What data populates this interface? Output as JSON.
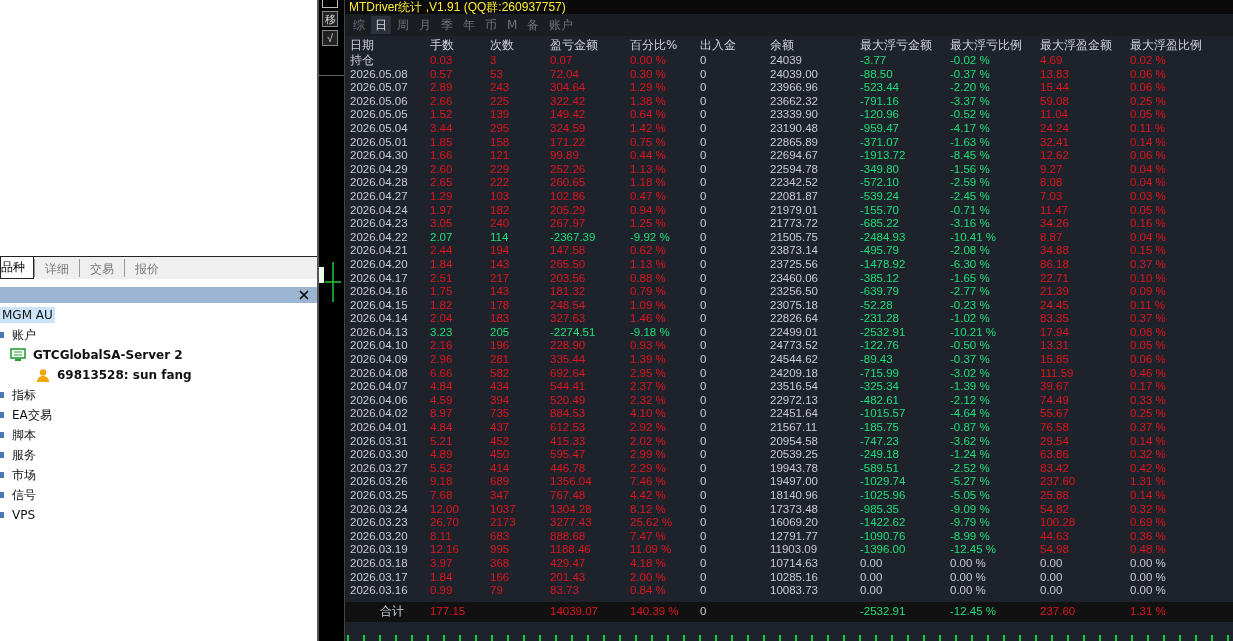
{
  "left_panel": {
    "tabs": [
      {
        "label": "品种",
        "selected": true
      },
      {
        "label": "详细",
        "selected": false
      },
      {
        "label": "交易",
        "selected": false
      },
      {
        "label": "报价",
        "selected": false
      }
    ],
    "navigator": {
      "items": [
        {
          "label": "MGM AU",
          "kind": "root",
          "selected": true
        },
        {
          "label": "账户",
          "kind": "accounts",
          "selected": false,
          "children": [
            {
              "label": "GTCGlobalSA-Server 2",
              "kind": "server",
              "selected": false,
              "children": [
                {
                  "label": "69813528: sun fang",
                  "kind": "user",
                  "selected": false
                }
              ]
            }
          ]
        },
        {
          "label": "指标",
          "kind": "folder",
          "selected": false
        },
        {
          "label": "EA交易",
          "kind": "folder",
          "selected": false
        },
        {
          "label": "脚本",
          "kind": "folder",
          "selected": false
        },
        {
          "label": "服务",
          "kind": "folder",
          "selected": false
        },
        {
          "label": "市场",
          "kind": "folder",
          "selected": false
        },
        {
          "label": "信号",
          "kind": "folder",
          "selected": false
        },
        {
          "label": "VPS",
          "kind": "folder",
          "selected": false
        }
      ]
    }
  },
  "side_buttons": [
    "移",
    "√"
  ],
  "stats": {
    "title": "MTDriver统计 ,V1.91 (QQ群:260937757)",
    "tabs": [
      {
        "label": "综",
        "selected": false
      },
      {
        "label": "日",
        "selected": true
      },
      {
        "label": "周",
        "selected": false
      },
      {
        "label": "月",
        "selected": false
      },
      {
        "label": "季",
        "selected": false
      },
      {
        "label": "年",
        "selected": false
      },
      {
        "label": "币",
        "selected": false
      },
      {
        "label": "M",
        "selected": false
      },
      {
        "label": "备",
        "selected": false
      },
      {
        "label": "账户",
        "selected": false
      }
    ],
    "columns": [
      "日期",
      "手数",
      "次数",
      "盈亏金额",
      "百分比%",
      "出入金",
      "余额",
      "最大浮亏金额",
      "最大浮亏比例",
      "最大浮盈金额",
      "最大浮盈比例"
    ],
    "rows": [
      {
        "cells": [
          "持仓",
          "0.03",
          "3",
          "0.07",
          "0.00 %",
          "0",
          "24039",
          "-3.77",
          "-0.02 %",
          "4.69",
          "0.02 %"
        ],
        "loss": false,
        "floating": true
      },
      {
        "cells": [
          "2026.05.08",
          "0.57",
          "53",
          "72.04",
          "0.30 %",
          "0",
          "24039.00",
          "-88.50",
          "-0.37 %",
          "13.83",
          "0.06 %"
        ],
        "loss": false,
        "floating": true
      },
      {
        "cells": [
          "2026.05.07",
          "2.89",
          "243",
          "304.64",
          "1.29 %",
          "0",
          "23966.96",
          "-523.44",
          "-2.20 %",
          "15.44",
          "0.06 %"
        ],
        "loss": false,
        "floating": true
      },
      {
        "cells": [
          "2026.05.06",
          "2.66",
          "225",
          "322.42",
          "1.38 %",
          "0",
          "23662.32",
          "-791.16",
          "-3.37 %",
          "59.08",
          "0.25 %"
        ],
        "loss": false,
        "floating": true
      },
      {
        "cells": [
          "2026.05.05",
          "1.52",
          "139",
          "149.42",
          "0.64 %",
          "0",
          "23339.90",
          "-120.96",
          "-0.52 %",
          "11.04",
          "0.05 %"
        ],
        "loss": false,
        "floating": true
      },
      {
        "cells": [
          "2026.05.04",
          "3.44",
          "295",
          "324.59",
          "1.42 %",
          "0",
          "23190.48",
          "-959.47",
          "-4.17 %",
          "24.24",
          "0.11 %"
        ],
        "loss": false,
        "floating": true
      },
      {
        "cells": [
          "2026.05.01",
          "1.85",
          "158",
          "171.22",
          "0.75 %",
          "0",
          "22865.89",
          "-371.07",
          "-1.63 %",
          "32.41",
          "0.14 %"
        ],
        "loss": false,
        "floating": true
      },
      {
        "cells": [
          "2026.04.30",
          "1.66",
          "121",
          "99.89",
          "0.44 %",
          "0",
          "22694.67",
          "-1913.72",
          "-8.45 %",
          "12.62",
          "0.06 %"
        ],
        "loss": false,
        "floating": true
      },
      {
        "cells": [
          "2026.04.29",
          "2.60",
          "229",
          "252.26",
          "1.13 %",
          "0",
          "22594.78",
          "-349.80",
          "-1.56 %",
          "9.27",
          "0.04 %"
        ],
        "loss": false,
        "floating": true
      },
      {
        "cells": [
          "2026.04.28",
          "2.65",
          "222",
          "260.65",
          "1.18 %",
          "0",
          "22342.52",
          "-572.10",
          "-2.59 %",
          "8.08",
          "0.04 %"
        ],
        "loss": false,
        "floating": true
      },
      {
        "cells": [
          "2026.04.27",
          "1.29",
          "103",
          "102.86",
          "0.47 %",
          "0",
          "22081.87",
          "-539.24",
          "-2.45 %",
          "7.03",
          "0.03 %"
        ],
        "loss": false,
        "floating": true
      },
      {
        "cells": [
          "2026.04.24",
          "1.97",
          "182",
          "205.29",
          "0.94 %",
          "0",
          "21979.01",
          "-155.70",
          "-0.71 %",
          "11.47",
          "0.05 %"
        ],
        "loss": false,
        "floating": true
      },
      {
        "cells": [
          "2026.04.23",
          "3.05",
          "240",
          "267.97",
          "1.25 %",
          "0",
          "21773.72",
          "-685.22",
          "-3.16 %",
          "34.26",
          "0.16 %"
        ],
        "loss": false,
        "floating": true
      },
      {
        "cells": [
          "2026.04.22",
          "2.07",
          "114",
          "-2367.39",
          "-9.92 %",
          "0",
          "21505.75",
          "-2484.93",
          "-10.41 %",
          "8.87",
          "0.04 %"
        ],
        "loss": true,
        "floating": true
      },
      {
        "cells": [
          "2026.04.21",
          "2.44",
          "194",
          "147.58",
          "0.62 %",
          "0",
          "23873.14",
          "-495.79",
          "-2.08 %",
          "34.88",
          "0.15 %"
        ],
        "loss": false,
        "floating": true
      },
      {
        "cells": [
          "2026.04.20",
          "1.84",
          "143",
          "265.50",
          "1.13 %",
          "0",
          "23725.56",
          "-1478.92",
          "-6.30 %",
          "86.18",
          "0.37 %"
        ],
        "loss": false,
        "floating": true
      },
      {
        "cells": [
          "2026.04.17",
          "2.51",
          "217",
          "203.56",
          "0.88 %",
          "0",
          "23460.06",
          "-385.12",
          "-1.65 %",
          "22.71",
          "0.10 %"
        ],
        "loss": false,
        "floating": true
      },
      {
        "cells": [
          "2026.04.16",
          "1.75",
          "143",
          "181.32",
          "0.79 %",
          "0",
          "23256.50",
          "-639.79",
          "-2.77 %",
          "21.39",
          "0.09 %"
        ],
        "loss": false,
        "floating": true
      },
      {
        "cells": [
          "2026.04.15",
          "1.82",
          "178",
          "248.54",
          "1.09 %",
          "0",
          "23075.18",
          "-52.28",
          "-0.23 %",
          "24.45",
          "0.11 %"
        ],
        "loss": false,
        "floating": true
      },
      {
        "cells": [
          "2026.04.14",
          "2.04",
          "183",
          "327.63",
          "1.46 %",
          "0",
          "22826.64",
          "-231.28",
          "-1.02 %",
          "83.35",
          "0.37 %"
        ],
        "loss": false,
        "floating": true
      },
      {
        "cells": [
          "2026.04.13",
          "3.23",
          "205",
          "-2274.51",
          "-9.18 %",
          "0",
          "22499.01",
          "-2532.91",
          "-10.21 %",
          "17.94",
          "0.08 %"
        ],
        "loss": true,
        "floating": true
      },
      {
        "cells": [
          "2026.04.10",
          "2.16",
          "196",
          "228.90",
          "0.93 %",
          "0",
          "24773.52",
          "-122.76",
          "-0.50 %",
          "13.31",
          "0.05 %"
        ],
        "loss": false,
        "floating": true
      },
      {
        "cells": [
          "2026.04.09",
          "2.96",
          "281",
          "335.44",
          "1.39 %",
          "0",
          "24544.62",
          "-89.43",
          "-0.37 %",
          "15.85",
          "0.06 %"
        ],
        "loss": false,
        "floating": true
      },
      {
        "cells": [
          "2026.04.08",
          "6.66",
          "582",
          "692.64",
          "2.95 %",
          "0",
          "24209.18",
          "-715.99",
          "-3.02 %",
          "111.59",
          "0.46 %"
        ],
        "loss": false,
        "floating": true
      },
      {
        "cells": [
          "2026.04.07",
          "4.84",
          "434",
          "544.41",
          "2.37 %",
          "0",
          "23516.54",
          "-325.34",
          "-1.39 %",
          "39.67",
          "0.17 %"
        ],
        "loss": false,
        "floating": true
      },
      {
        "cells": [
          "2026.04.06",
          "4.59",
          "394",
          "520.49",
          "2.32 %",
          "0",
          "22972.13",
          "-482.61",
          "-2.12 %",
          "74.49",
          "0.33 %"
        ],
        "loss": false,
        "floating": true
      },
      {
        "cells": [
          "2026.04.02",
          "8.97",
          "735",
          "884.53",
          "4.10 %",
          "0",
          "22451.64",
          "-1015.57",
          "-4.64 %",
          "55.67",
          "0.25 %"
        ],
        "loss": false,
        "floating": true
      },
      {
        "cells": [
          "2026.04.01",
          "4.84",
          "437",
          "612.53",
          "2.92 %",
          "0",
          "21567.11",
          "-185.75",
          "-0.87 %",
          "76.58",
          "0.37 %"
        ],
        "loss": false,
        "floating": true
      },
      {
        "cells": [
          "2026.03.31",
          "5.21",
          "452",
          "415.33",
          "2.02 %",
          "0",
          "20954.58",
          "-747.23",
          "-3.62 %",
          "29.54",
          "0.14 %"
        ],
        "loss": false,
        "floating": true
      },
      {
        "cells": [
          "2026.03.30",
          "4.89",
          "450",
          "595.47",
          "2.99 %",
          "0",
          "20539.25",
          "-249.18",
          "-1.24 %",
          "63.86",
          "0.32 %"
        ],
        "loss": false,
        "floating": true
      },
      {
        "cells": [
          "2026.03.27",
          "5.52",
          "414",
          "446.78",
          "2.29 %",
          "0",
          "19943.78",
          "-589.51",
          "-2.52 %",
          "83.42",
          "0.42 %"
        ],
        "loss": false,
        "floating": true
      },
      {
        "cells": [
          "2026.03.26",
          "9.18",
          "689",
          "1356.04",
          "7.46 %",
          "0",
          "19497.00",
          "-1029.74",
          "-5.27 %",
          "237.60",
          "1.31 %"
        ],
        "loss": false,
        "floating": true
      },
      {
        "cells": [
          "2026.03.25",
          "7.68",
          "347",
          "767.48",
          "4.42 %",
          "0",
          "18140.96",
          "-1025.96",
          "-5.05 %",
          "25.88",
          "0.14 %"
        ],
        "loss": false,
        "floating": true
      },
      {
        "cells": [
          "2026.03.24",
          "12.00",
          "1037",
          "1304.28",
          "8.12 %",
          "0",
          "17373.48",
          "-985.35",
          "-9.09 %",
          "54.82",
          "0.32 %"
        ],
        "loss": false,
        "floating": true
      },
      {
        "cells": [
          "2026.03.23",
          "26.70",
          "2173",
          "3277.43",
          "25.62 %",
          "0",
          "16069.20",
          "-1422.62",
          "-9.79 %",
          "100.28",
          "0.69 %"
        ],
        "loss": false,
        "floating": true
      },
      {
        "cells": [
          "2026.03.20",
          "8.11",
          "683",
          "888.68",
          "7.47 %",
          "0",
          "12791.77",
          "-1090.76",
          "-8.99 %",
          "44.63",
          "0.36 %"
        ],
        "loss": false,
        "floating": true
      },
      {
        "cells": [
          "2026.03.19",
          "12.16",
          "995",
          "1188.46",
          "11.09 %",
          "0",
          "11903.09",
          "-1396.00",
          "-12.45 %",
          "54.98",
          "0.48 %"
        ],
        "loss": false,
        "floating": true
      },
      {
        "cells": [
          "2026.03.18",
          "3.97",
          "368",
          "429.47",
          "4.18 %",
          "0",
          "10714.63",
          "0.00",
          "0.00 %",
          "0.00",
          "0.00 %"
        ],
        "loss": false,
        "floating": false
      },
      {
        "cells": [
          "2026.03.17",
          "1.84",
          "166",
          "201.43",
          "2.00 %",
          "0",
          "10285.16",
          "0.00",
          "0.00 %",
          "0.00",
          "0.00 %"
        ],
        "loss": false,
        "floating": false
      },
      {
        "cells": [
          "2026.03.16",
          "0.99",
          "79",
          "83.73",
          "0.84 %",
          "0",
          "10083.73",
          "0.00",
          "0.00 %",
          "0.00",
          "0.00 %"
        ],
        "loss": false,
        "floating": false
      }
    ],
    "total": {
      "cells": [
        "合计",
        "177.15",
        "",
        "14039.07",
        "140.39 %",
        "0",
        "",
        "-2532.91",
        "-12.45 %",
        "237.60",
        "1.31 %"
      ]
    }
  }
}
